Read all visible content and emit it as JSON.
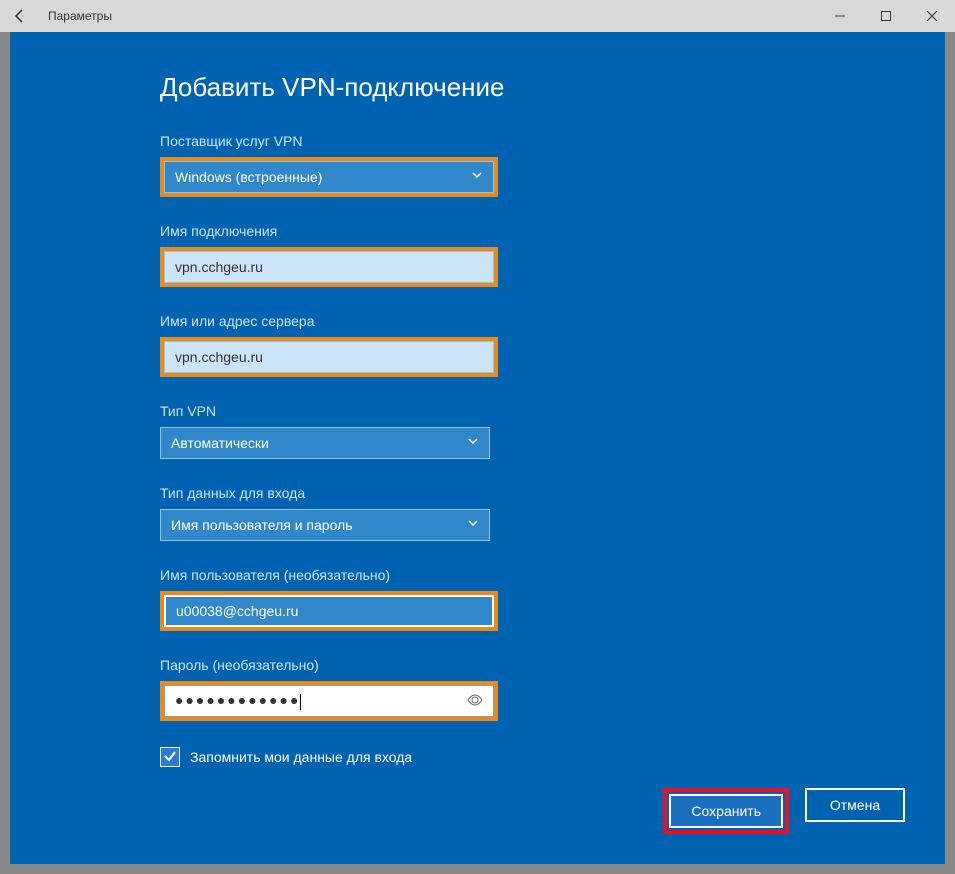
{
  "titlebar": {
    "title": "Параметры"
  },
  "dialog": {
    "title": "Добавить VPN-подключение",
    "provider": {
      "label": "Поставщик услуг VPN",
      "value": "Windows (встроенные)"
    },
    "connection_name": {
      "label": "Имя подключения",
      "value": "vpn.cchgeu.ru"
    },
    "server_address": {
      "label": "Имя или адрес сервера",
      "value": "vpn.cchgeu.ru"
    },
    "vpn_type": {
      "label": "Тип VPN",
      "value": "Автоматически"
    },
    "auth_type": {
      "label": "Тип данных для входа",
      "value": "Имя пользователя и пароль"
    },
    "username": {
      "label": "Имя пользователя (необязательно)",
      "value": "u00038@cchgeu.ru"
    },
    "password": {
      "label": "Пароль (необязательно)",
      "value": "●●●●●●●●●●●●"
    },
    "remember": {
      "label": "Запомнить мои данные для входа"
    },
    "buttons": {
      "save": "Сохранить",
      "cancel": "Отмена"
    }
  }
}
